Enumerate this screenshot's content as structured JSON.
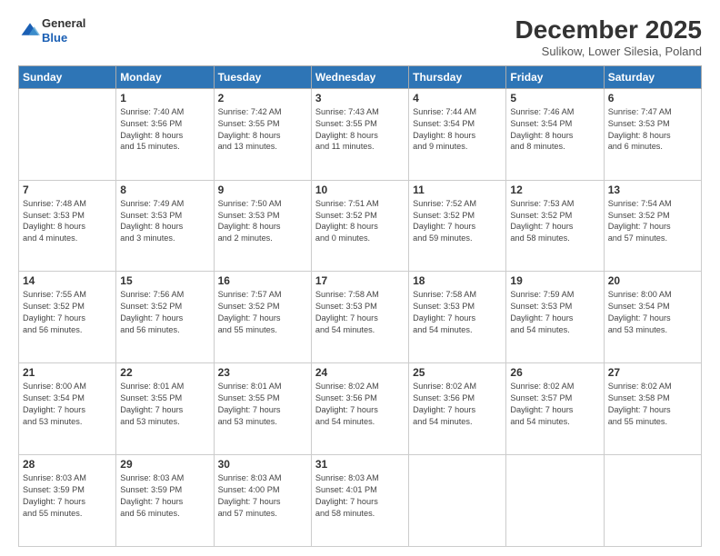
{
  "header": {
    "logo": {
      "general": "General",
      "blue": "Blue"
    },
    "title": "December 2025",
    "location": "Sulikow, Lower Silesia, Poland"
  },
  "days_of_week": [
    "Sunday",
    "Monday",
    "Tuesday",
    "Wednesday",
    "Thursday",
    "Friday",
    "Saturday"
  ],
  "weeks": [
    [
      {
        "day": "",
        "info": ""
      },
      {
        "day": "1",
        "info": "Sunrise: 7:40 AM\nSunset: 3:56 PM\nDaylight: 8 hours\nand 15 minutes."
      },
      {
        "day": "2",
        "info": "Sunrise: 7:42 AM\nSunset: 3:55 PM\nDaylight: 8 hours\nand 13 minutes."
      },
      {
        "day": "3",
        "info": "Sunrise: 7:43 AM\nSunset: 3:55 PM\nDaylight: 8 hours\nand 11 minutes."
      },
      {
        "day": "4",
        "info": "Sunrise: 7:44 AM\nSunset: 3:54 PM\nDaylight: 8 hours\nand 9 minutes."
      },
      {
        "day": "5",
        "info": "Sunrise: 7:46 AM\nSunset: 3:54 PM\nDaylight: 8 hours\nand 8 minutes."
      },
      {
        "day": "6",
        "info": "Sunrise: 7:47 AM\nSunset: 3:53 PM\nDaylight: 8 hours\nand 6 minutes."
      }
    ],
    [
      {
        "day": "7",
        "info": "Sunrise: 7:48 AM\nSunset: 3:53 PM\nDaylight: 8 hours\nand 4 minutes."
      },
      {
        "day": "8",
        "info": "Sunrise: 7:49 AM\nSunset: 3:53 PM\nDaylight: 8 hours\nand 3 minutes."
      },
      {
        "day": "9",
        "info": "Sunrise: 7:50 AM\nSunset: 3:53 PM\nDaylight: 8 hours\nand 2 minutes."
      },
      {
        "day": "10",
        "info": "Sunrise: 7:51 AM\nSunset: 3:52 PM\nDaylight: 8 hours\nand 0 minutes."
      },
      {
        "day": "11",
        "info": "Sunrise: 7:52 AM\nSunset: 3:52 PM\nDaylight: 7 hours\nand 59 minutes."
      },
      {
        "day": "12",
        "info": "Sunrise: 7:53 AM\nSunset: 3:52 PM\nDaylight: 7 hours\nand 58 minutes."
      },
      {
        "day": "13",
        "info": "Sunrise: 7:54 AM\nSunset: 3:52 PM\nDaylight: 7 hours\nand 57 minutes."
      }
    ],
    [
      {
        "day": "14",
        "info": "Sunrise: 7:55 AM\nSunset: 3:52 PM\nDaylight: 7 hours\nand 56 minutes."
      },
      {
        "day": "15",
        "info": "Sunrise: 7:56 AM\nSunset: 3:52 PM\nDaylight: 7 hours\nand 56 minutes."
      },
      {
        "day": "16",
        "info": "Sunrise: 7:57 AM\nSunset: 3:52 PM\nDaylight: 7 hours\nand 55 minutes."
      },
      {
        "day": "17",
        "info": "Sunrise: 7:58 AM\nSunset: 3:53 PM\nDaylight: 7 hours\nand 54 minutes."
      },
      {
        "day": "18",
        "info": "Sunrise: 7:58 AM\nSunset: 3:53 PM\nDaylight: 7 hours\nand 54 minutes."
      },
      {
        "day": "19",
        "info": "Sunrise: 7:59 AM\nSunset: 3:53 PM\nDaylight: 7 hours\nand 54 minutes."
      },
      {
        "day": "20",
        "info": "Sunrise: 8:00 AM\nSunset: 3:54 PM\nDaylight: 7 hours\nand 53 minutes."
      }
    ],
    [
      {
        "day": "21",
        "info": "Sunrise: 8:00 AM\nSunset: 3:54 PM\nDaylight: 7 hours\nand 53 minutes."
      },
      {
        "day": "22",
        "info": "Sunrise: 8:01 AM\nSunset: 3:55 PM\nDaylight: 7 hours\nand 53 minutes."
      },
      {
        "day": "23",
        "info": "Sunrise: 8:01 AM\nSunset: 3:55 PM\nDaylight: 7 hours\nand 53 minutes."
      },
      {
        "day": "24",
        "info": "Sunrise: 8:02 AM\nSunset: 3:56 PM\nDaylight: 7 hours\nand 54 minutes."
      },
      {
        "day": "25",
        "info": "Sunrise: 8:02 AM\nSunset: 3:56 PM\nDaylight: 7 hours\nand 54 minutes."
      },
      {
        "day": "26",
        "info": "Sunrise: 8:02 AM\nSunset: 3:57 PM\nDaylight: 7 hours\nand 54 minutes."
      },
      {
        "day": "27",
        "info": "Sunrise: 8:02 AM\nSunset: 3:58 PM\nDaylight: 7 hours\nand 55 minutes."
      }
    ],
    [
      {
        "day": "28",
        "info": "Sunrise: 8:03 AM\nSunset: 3:59 PM\nDaylight: 7 hours\nand 55 minutes."
      },
      {
        "day": "29",
        "info": "Sunrise: 8:03 AM\nSunset: 3:59 PM\nDaylight: 7 hours\nand 56 minutes."
      },
      {
        "day": "30",
        "info": "Sunrise: 8:03 AM\nSunset: 4:00 PM\nDaylight: 7 hours\nand 57 minutes."
      },
      {
        "day": "31",
        "info": "Sunrise: 8:03 AM\nSunset: 4:01 PM\nDaylight: 7 hours\nand 58 minutes."
      },
      {
        "day": "",
        "info": ""
      },
      {
        "day": "",
        "info": ""
      },
      {
        "day": "",
        "info": ""
      }
    ]
  ]
}
